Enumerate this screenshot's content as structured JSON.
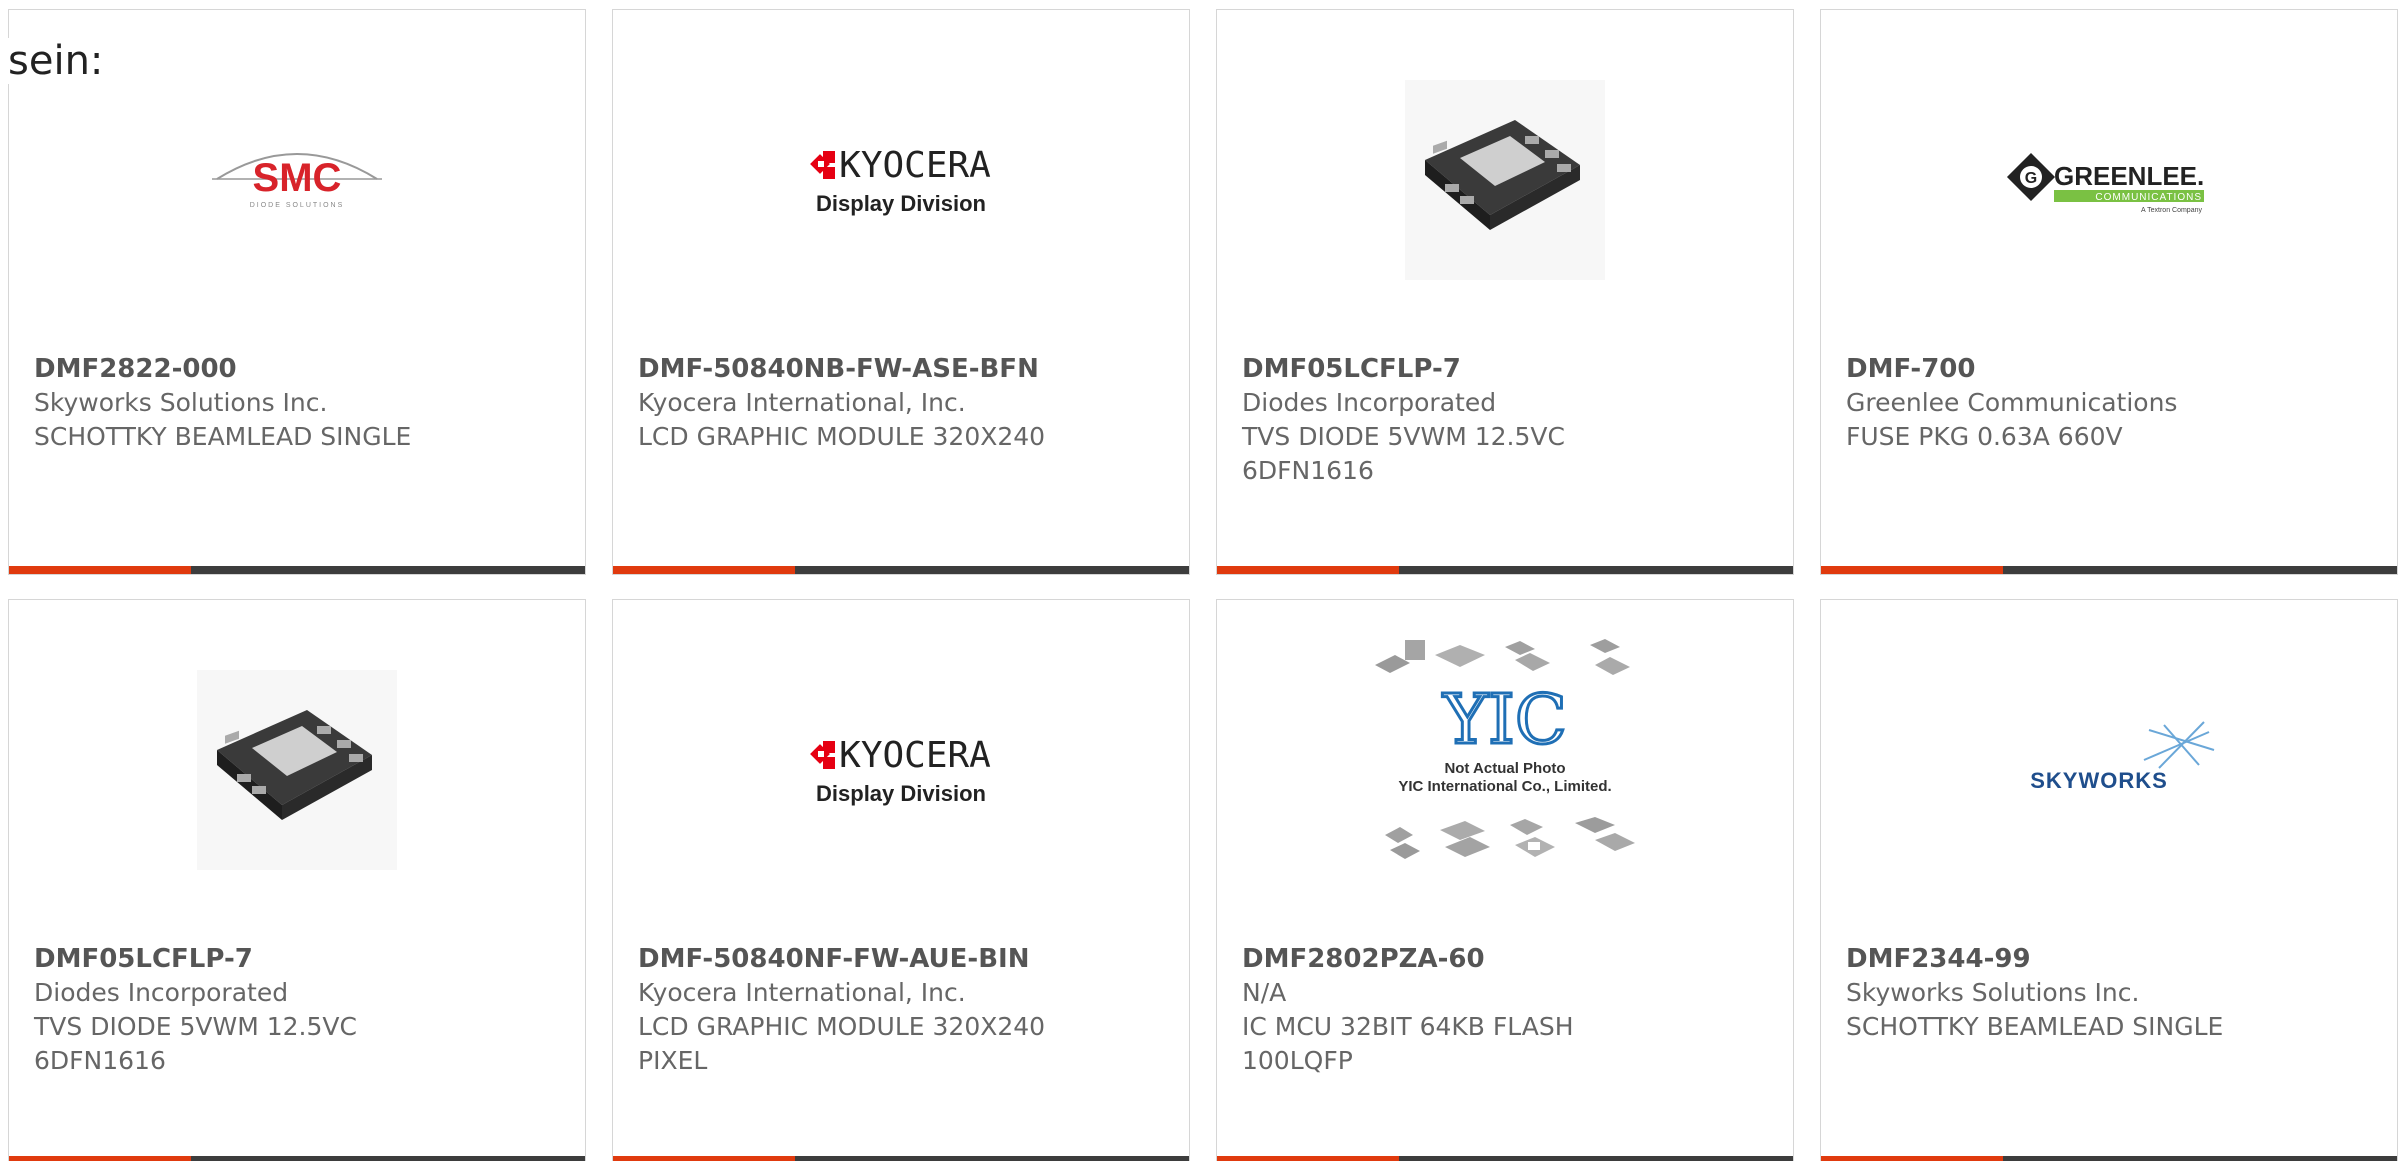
{
  "intro_text": "sein:",
  "brand_colors": {
    "accent": "#e03a0e",
    "bar": "#3d3d3d",
    "smc_red": "#d8232a",
    "kyocera_red": "#e60012",
    "greenlee_green": "#7ac143",
    "skyworks_blue": "#1f4e8c"
  },
  "cards": [
    {
      "part_number": "DMF2822-000",
      "manufacturer": "Skyworks Solutions Inc.",
      "desc1": "SCHOTTKY BEAMLEAD SINGLE",
      "desc2": "",
      "image": "smc-logo",
      "logo": {
        "main": "SMC",
        "sub": "DIODE SOLUTIONS"
      }
    },
    {
      "part_number": "DMF-50840NB-FW-ASE-BFN",
      "manufacturer": "Kyocera International, Inc.",
      "desc1": "LCD GRAPHIC MODULE 320X240",
      "desc2": "",
      "image": "kyocera-logo",
      "logo": {
        "main": "KYOCERA",
        "sub": "Display Division"
      }
    },
    {
      "part_number": "DMF05LCFLP-7",
      "manufacturer": "Diodes Incorporated",
      "desc1": "TVS DIODE 5VWM 12.5VC",
      "desc2": "6DFN1616",
      "image": "dfn-chip-photo"
    },
    {
      "part_number": "DMF-700",
      "manufacturer": "Greenlee Communications",
      "desc1": "FUSE PKG 0.63A 660V",
      "desc2": "",
      "image": "greenlee-logo",
      "logo": {
        "main": "GREENLEE.",
        "sub": "COMMUNICATIONS",
        "tag": "A Textron Company"
      }
    },
    {
      "part_number": "DMF05LCFLP-7",
      "manufacturer": "Diodes Incorporated",
      "desc1": "TVS DIODE 5VWM 12.5VC",
      "desc2": "6DFN1616",
      "image": "dfn-chip-photo"
    },
    {
      "part_number": "DMF-50840NF-FW-AUE-BIN",
      "manufacturer": "Kyocera International, Inc.",
      "desc1": "LCD GRAPHIC MODULE 320X240",
      "desc2": "PIXEL",
      "image": "kyocera-logo",
      "logo": {
        "main": "KYOCERA",
        "sub": "Display Division"
      }
    },
    {
      "part_number": "DMF2802PZA-60",
      "manufacturer": "N/A",
      "desc1": "IC MCU 32BIT 64KB FLASH",
      "desc2": "100LQFP",
      "image": "yic-placeholder",
      "logo": {
        "main": "YIC",
        "line1": "Not Actual Photo",
        "line2": "YIC International Co., Limited."
      }
    },
    {
      "part_number": "DMF2344-99",
      "manufacturer": "Skyworks Solutions Inc.",
      "desc1": "SCHOTTKY BEAMLEAD SINGLE",
      "desc2": "",
      "image": "skyworks-logo",
      "logo": {
        "main": "SKYWORKS"
      }
    }
  ]
}
